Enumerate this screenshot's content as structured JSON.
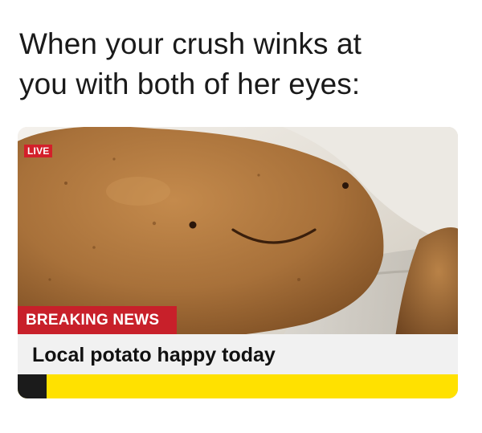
{
  "caption": {
    "line1": "When your crush winks at",
    "line2": "you with both of her eyes:"
  },
  "photo": {
    "subject": "potato-with-smiley-face",
    "live_label": "LIVE",
    "breaking_label": "BREAKING NEWS",
    "headline": "Local potato happy today",
    "colors": {
      "live_red": "#d3202a",
      "breaking_red": "#c8202a",
      "headline_bg": "#f1f1f1",
      "ticker_yellow": "#ffe100",
      "potato_brown": "#a8713a"
    }
  }
}
